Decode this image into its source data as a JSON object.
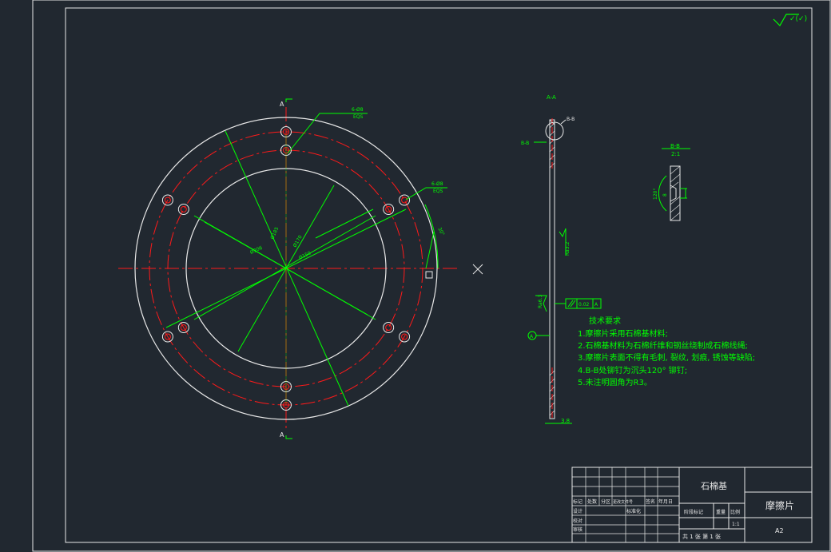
{
  "colors": {
    "background": "#212830",
    "line": "#e8e8e8",
    "dim": "#00ff00",
    "center": "#ff1a1a",
    "text_tech": "#00ff00"
  },
  "roughness_mark": "✓(✓)",
  "section_mark": "A",
  "section_aa": "A-A",
  "section_bb": "B-B",
  "detail_bb_title": "B-B",
  "detail_bb_scale": "2:1",
  "detail_angle": "120°",
  "detail_dim": "8",
  "dims": {
    "holes_inner": "6-Ø8",
    "holes_inner_sub": "EQS",
    "holes_outer": "6-Ø8",
    "holes_outer_sub": "EQS",
    "d_outer": "Ø206",
    "d_pcd_outer": "Ø185",
    "d_pcd_inner": "Ø170",
    "d_inner": "Ø150",
    "angle": "30°",
    "thickness": "3.8",
    "rough_side": "Ra3.2",
    "rough_face": "Ra6.3",
    "parallel": "0.02",
    "datum": "A"
  },
  "tech": {
    "title": "技术要求",
    "items": [
      "1.摩擦片采用石棉基材料;",
      "2.石棉基材料为石棉纤维和钢丝绕制成石棉线绳;",
      "3.摩擦片表面不得有毛刺, 裂纹, 划痕, 锈蚀等缺陷;",
      "4.B-B处铆钉为沉头120° 铆钉;",
      "5.未注明圆角为R3。"
    ]
  },
  "title_block": {
    "material": "石棉基",
    "part_name": "摩擦片",
    "sheet_size": "A2",
    "rows": [
      "标记",
      "设计",
      "校对",
      "审核"
    ],
    "cols": [
      "处数",
      "分区",
      "更改文件号",
      "签名",
      "年月日"
    ],
    "standardization": "标准化",
    "stage_mark": "阶段标记",
    "weight": "重量",
    "scale": "比例",
    "scale_value": "1:1",
    "sheets": "共 1 张   第 1 张"
  }
}
